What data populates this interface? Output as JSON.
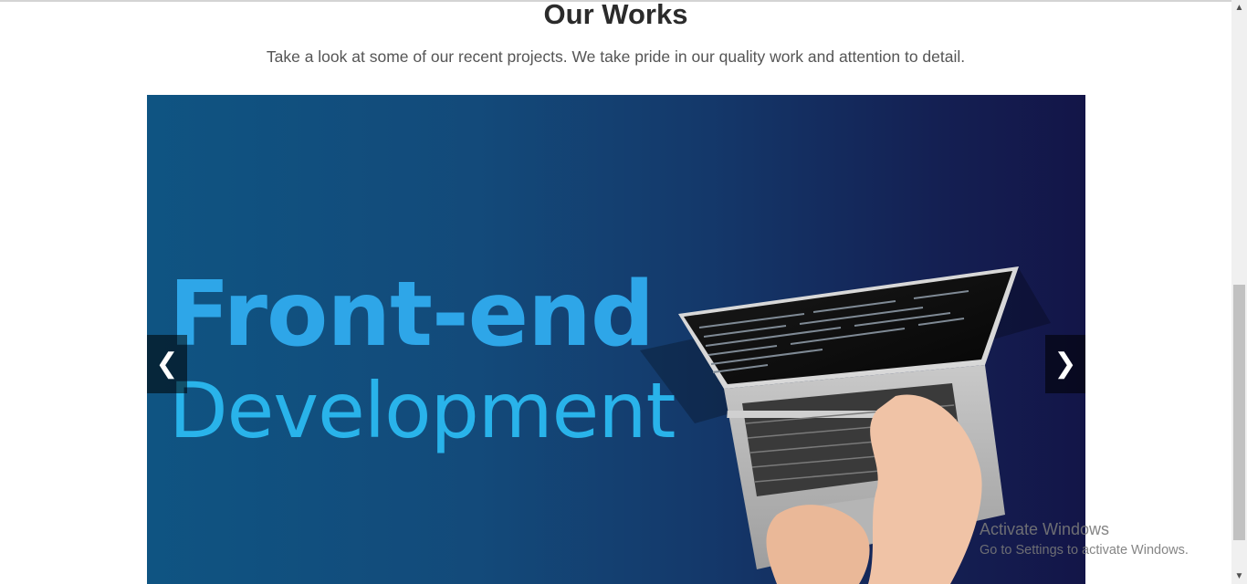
{
  "section": {
    "title": "Our Works",
    "subtitle": "Take a look at some of our recent projects. We take pride in our quality work and attention to detail."
  },
  "slider": {
    "slide_line_1": "Front-end",
    "slide_line_2": "Development",
    "prev_label": "❮",
    "next_label": "❯"
  },
  "watermark": {
    "title": "Activate Windows",
    "subtitle": "Go to Settings to activate Windows."
  },
  "scrollbar": {
    "up_arrow": "▲",
    "down_arrow": "▼"
  }
}
